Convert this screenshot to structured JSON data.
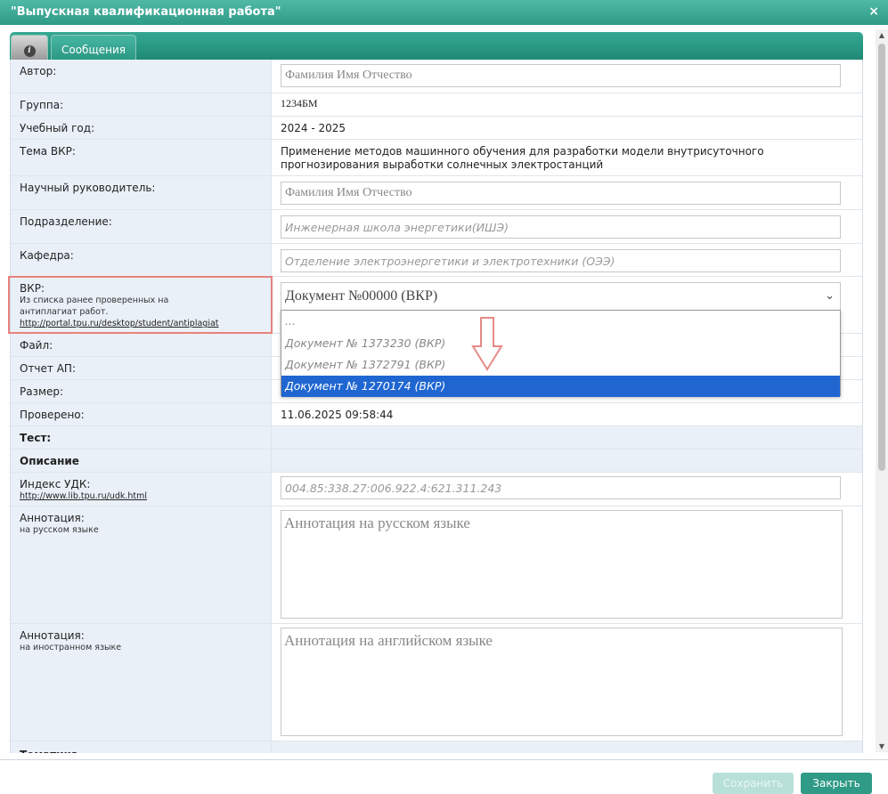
{
  "window": {
    "title": "\"Выпускная квалификационная работа\"",
    "close_glyph": "×"
  },
  "tabs": {
    "info_glyph": "i",
    "messages": "Сообщения"
  },
  "fields": {
    "author": {
      "label": "Автор:",
      "value": "Фамилия Имя Отчество"
    },
    "group": {
      "label": "Группа:",
      "value": "1234БМ"
    },
    "year": {
      "label": "Учебный год:",
      "value": "2024 - 2025"
    },
    "topic": {
      "label": "Тема ВКР:",
      "value": "Применение методов машинного обучения для разработки модели внутрисуточного прогнозирования выработки солнечных электростанций"
    },
    "supervisor": {
      "label": "Научный руководитель:",
      "value": "Фамилия Имя Отчество"
    },
    "division": {
      "label": "Подразделение:",
      "value": "Инженерная школа энергетики(ИШЭ)"
    },
    "department": {
      "label": "Кафедра:",
      "value": "Отделение электроэнергетики и электротехники (ОЭЭ)"
    },
    "vkr": {
      "label": "ВКР:",
      "hint1": "Из списка ранее проверенных на",
      "hint2": "антиплагиат работ.",
      "link": "http://portal.tpu.ru/desktop/student/antiplagiat",
      "selected": "Документ №00000 (ВКР)",
      "options": [
        "...",
        "Документ № 1373230 (ВКР)",
        "Документ № 1372791 (ВКР)",
        "Документ № 1270174 (ВКР)"
      ],
      "highlighted_option": 3
    },
    "file": {
      "label": "Файл:"
    },
    "ap_report": {
      "label": "Отчет АП:"
    },
    "size": {
      "label": "Размер:"
    },
    "checked": {
      "label": "Проверено:",
      "value": "11.06.2025 09:58:44"
    },
    "test_section": "Тест:",
    "description_section": "Описание",
    "udk": {
      "label": "Индекс УДК:",
      "link": "http://www.lib.tpu.ru/udk.html",
      "placeholder": "004.85:338.27:006.922.4:621.311.243"
    },
    "annotation_ru": {
      "label": "Аннотация:",
      "sub": "на русском языке",
      "placeholder": "Аннотация на русском языке"
    },
    "annotation_en": {
      "label": "Аннотация:",
      "sub": "на иностранном языке",
      "placeholder": "Аннотация на английском языке"
    },
    "topics_section": "Тематика"
  },
  "footer": {
    "save": "Сохранить",
    "close": "Закрыть"
  },
  "colors": {
    "header": "#2f9a86",
    "label_bg": "#eaf0f8",
    "highlight": "#e7837d",
    "selected_option": "#1f66d1"
  }
}
